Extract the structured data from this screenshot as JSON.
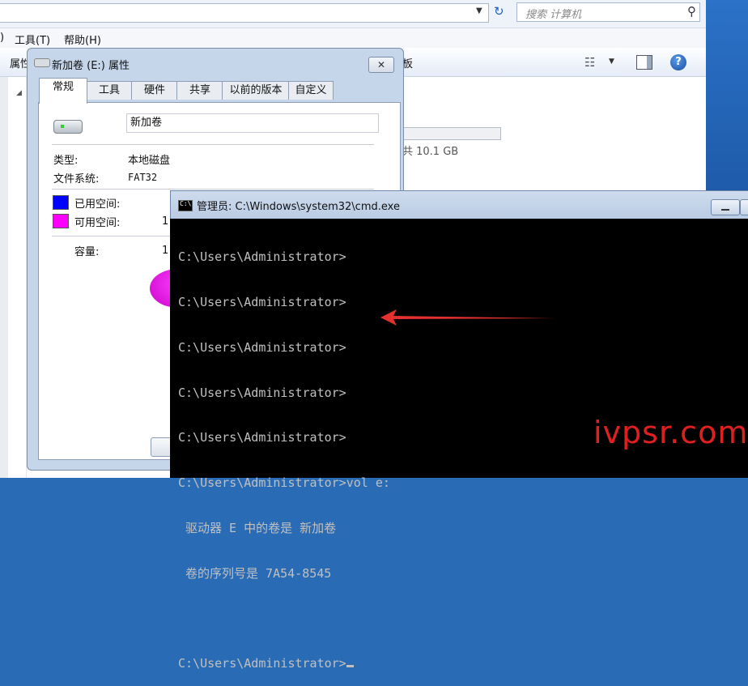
{
  "explorer": {
    "search_placeholder": "搜索 计算机",
    "menu": [
      "工具(T)",
      "帮助(H)"
    ],
    "menu_left_fragment": ")",
    "cmdbar_left_fragment": "属性",
    "cmdbar_right_fragment": "板",
    "drive_total": "共 10.1 GB"
  },
  "dialog": {
    "title": "新加卷 (E:) 属性",
    "close_label": "✕",
    "tabs": [
      "常规",
      "工具",
      "硬件",
      "共享",
      "以前的版本",
      "自定义"
    ],
    "volume_name": "新加卷",
    "type_label": "类型:",
    "type_value": "本地磁盘",
    "fs_label": "文件系统:",
    "fs_value": "FAT32",
    "used_label": "已用空间:",
    "free_label": "可用空间:",
    "free_value_fragment": "1",
    "capacity_label": "容量:",
    "capacity_value_fragment": "1",
    "colors": {
      "used": "#0000ff",
      "free": "#ff00ff"
    }
  },
  "cmd": {
    "title": "管理员: C:\\Windows\\system32\\cmd.exe",
    "icon_text": "C:\\",
    "lines": [
      "C:\\Users\\Administrator>",
      "C:\\Users\\Administrator>",
      "C:\\Users\\Administrator>",
      "C:\\Users\\Administrator>",
      "C:\\Users\\Administrator>",
      "C:\\Users\\Administrator>vol e:",
      " 驱动器 E 中的卷是 新加卷",
      " 卷的序列号是 7A54-8545",
      "",
      "C:\\Users\\Administrator>"
    ]
  },
  "watermark": "ivpsr.com",
  "accent": {
    "arrow": "#e53030"
  }
}
